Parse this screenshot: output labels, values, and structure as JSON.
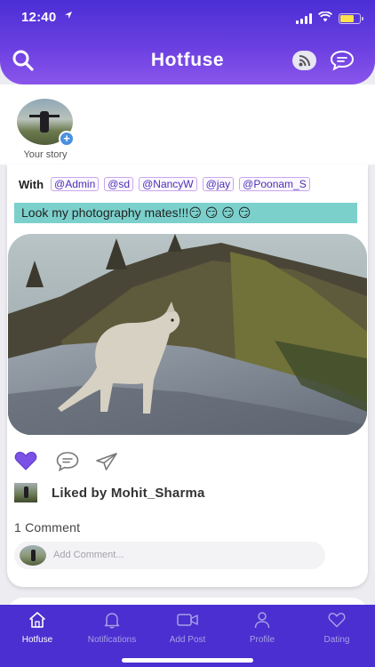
{
  "status_bar": {
    "time": "12:40"
  },
  "header": {
    "title": "Hotfuse"
  },
  "stories": [
    {
      "label": "Your story"
    }
  ],
  "post": {
    "with_label": "With",
    "tags": [
      "@Admin",
      "@sd",
      "@NancyW",
      "@jay",
      "@Poonam_S"
    ],
    "caption": "Look my photography mates!!!😏 😏 😏 😏",
    "liked_by": "Liked by Mohit_Sharma",
    "comment_count": "1 Comment",
    "comment_placeholder": "Add Comment..."
  },
  "tabs": [
    {
      "label": "Hotfuse",
      "icon": "home-icon",
      "active": true
    },
    {
      "label": "Notifications",
      "icon": "bell-icon",
      "active": false
    },
    {
      "label": "Add Post",
      "icon": "video-icon",
      "active": false
    },
    {
      "label": "Profile",
      "icon": "person-icon",
      "active": false
    },
    {
      "label": "Dating",
      "icon": "heart-icon",
      "active": false
    }
  ],
  "colors": {
    "accent": "#4b2fd0",
    "like": "#7b52e6",
    "caption_bg": "#7bd0cc"
  }
}
